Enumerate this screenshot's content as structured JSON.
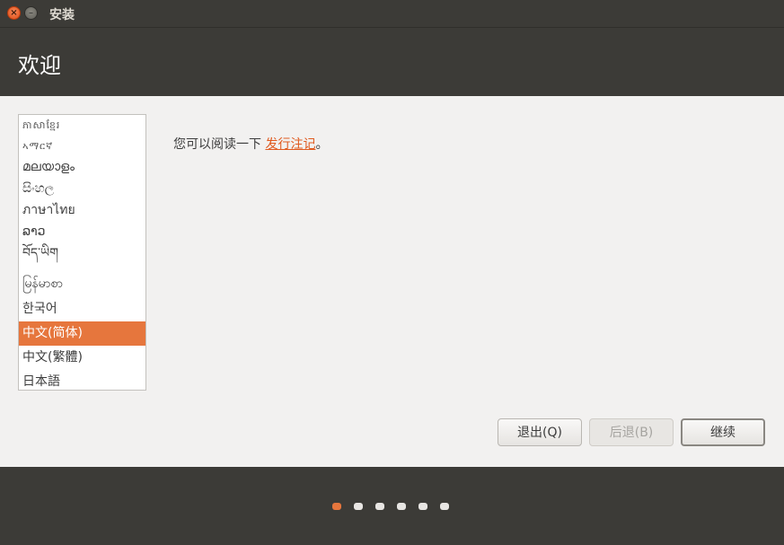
{
  "window": {
    "title": "安装"
  },
  "header": {
    "title": "欢迎"
  },
  "languages": [
    "ភាសាខ្មែរ",
    "ኣማርኛ",
    "മലയാളം",
    "සිංහල",
    "ภาษาไทย",
    "ລາວ",
    "བོད་ཡིག",
    "မြန်မာစာ",
    "한국어",
    "中文(简体)",
    "中文(繁體)",
    "日本語"
  ],
  "selected_language": "中文(简体)",
  "intro": {
    "prefix": "您可以阅读一下 ",
    "link": "发行注记",
    "suffix": "。"
  },
  "buttons": {
    "quit": "退出(Q)",
    "back": "后退(B)",
    "continue": "继续"
  },
  "progress": {
    "steps": 6,
    "current": 1
  },
  "colors": {
    "accent": "#e6763d",
    "link": "#e05a1f",
    "chrome": "#3c3b37"
  }
}
